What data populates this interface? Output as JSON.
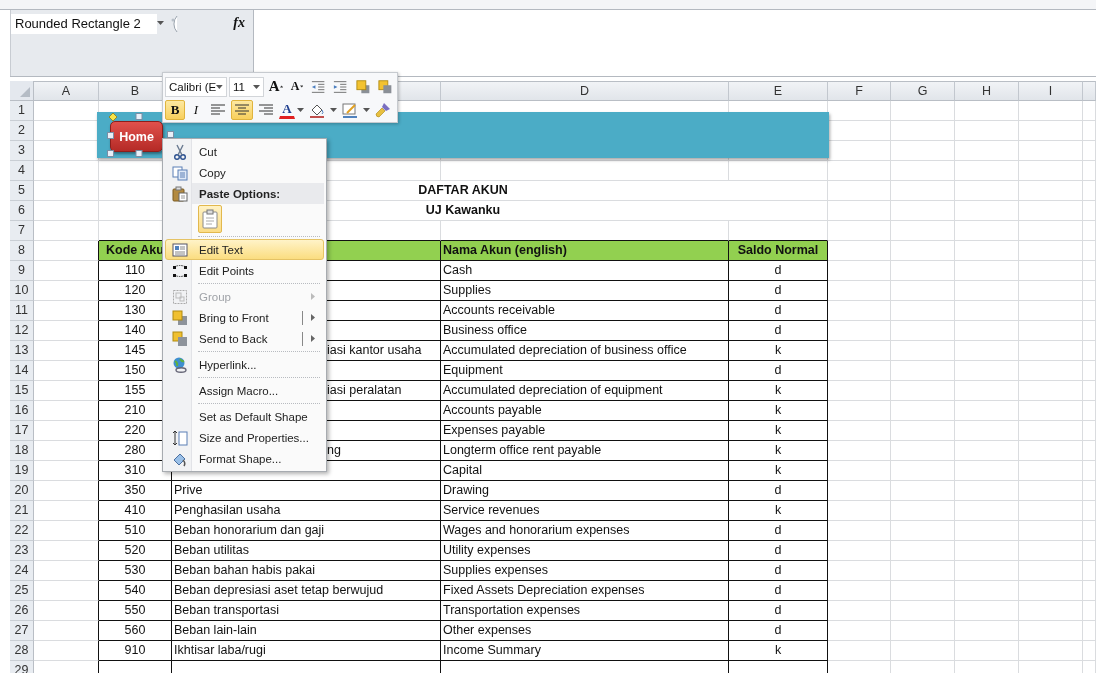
{
  "formula_bar": {
    "name_box": "Rounded Rectangle 2",
    "function_label": "fx"
  },
  "sheet": {
    "columns": [
      {
        "kind": "label",
        "label": "A"
      },
      {
        "kind": "label",
        "label": "B"
      },
      {
        "kind": "covered"
      },
      {
        "kind": "label",
        "label": "D"
      },
      {
        "kind": "label",
        "label": "E"
      },
      {
        "kind": "label",
        "label": "F"
      },
      {
        "kind": "label",
        "label": "G"
      },
      {
        "kind": "label",
        "label": "H"
      },
      {
        "kind": "label",
        "label": "I"
      }
    ],
    "rows": [
      {
        "number": "1",
        "kind": "under-shape"
      },
      {
        "number": "2",
        "kind": "under-shape"
      },
      {
        "number": "3",
        "kind": "under-shape"
      },
      {
        "number": "4",
        "kind": "empty"
      },
      {
        "number": "5",
        "kind": "title",
        "text": "DAFTAR AKUN"
      },
      {
        "number": "6",
        "kind": "title",
        "text": "UJ Kawanku"
      },
      {
        "number": "7",
        "kind": "empty"
      },
      {
        "number": "8",
        "kind": "header",
        "kode": "Kode Aku",
        "nama_english": "Nama Akun (english)",
        "saldo": "Saldo Normal"
      },
      {
        "number": "9",
        "kind": "data",
        "kode": "110",
        "nama_english": "Cash",
        "saldo": "d"
      },
      {
        "number": "10",
        "kind": "data",
        "kode": "120",
        "nama_english": "Supplies",
        "saldo": "d"
      },
      {
        "number": "11",
        "kind": "data",
        "kode": "130",
        "nama_english": "Accounts receivable",
        "saldo": "d"
      },
      {
        "number": "12",
        "kind": "data",
        "kode": "140",
        "nama_english": "Business office",
        "saldo": "d"
      },
      {
        "number": "13",
        "kind": "data",
        "kode": "145",
        "nama": "iasi kantor usaha",
        "covered": true,
        "nama_english": "Accumulated depreciation of business office",
        "saldo": "k"
      },
      {
        "number": "14",
        "kind": "data",
        "kode": "150",
        "nama_english": "Equipment",
        "saldo": "d"
      },
      {
        "number": "15",
        "kind": "data",
        "kode": "155",
        "nama": "iasi peralatan",
        "covered": true,
        "nama_english": "Accumulated depreciation of equipment",
        "saldo": "k"
      },
      {
        "number": "16",
        "kind": "data",
        "kode": "210",
        "nama_english": "Accounts payable",
        "saldo": "k"
      },
      {
        "number": "17",
        "kind": "data",
        "kode": "220",
        "nama_english": "Expenses payable",
        "saldo": "k"
      },
      {
        "number": "18",
        "kind": "data",
        "kode": "280",
        "nama": "ng",
        "covered": true,
        "nama_english": "Longterm office rent payable",
        "saldo": "k"
      },
      {
        "number": "19",
        "kind": "data",
        "kode": "310",
        "nama_english": "Capital",
        "saldo": "k"
      },
      {
        "number": "20",
        "kind": "data",
        "kode": "350",
        "nama": "Prive",
        "nama_english": "Drawing",
        "saldo": "d"
      },
      {
        "number": "21",
        "kind": "data",
        "kode": "410",
        "nama": "Penghasilan usaha",
        "nama_english": "Service revenues",
        "saldo": "k"
      },
      {
        "number": "22",
        "kind": "data",
        "kode": "510",
        "nama": "Beban honorarium dan gaji",
        "nama_english": "Wages and honorarium expenses",
        "saldo": "d"
      },
      {
        "number": "23",
        "kind": "data",
        "kode": "520",
        "nama": "Beban utilitas",
        "nama_english": "Utility expenses",
        "saldo": "d"
      },
      {
        "number": "24",
        "kind": "data",
        "kode": "530",
        "nama": "Beban bahan habis pakai",
        "nama_english": "Supplies expenses",
        "saldo": "d"
      },
      {
        "number": "25",
        "kind": "data",
        "kode": "540",
        "nama": "Beban depresiasi aset tetap berwujud",
        "nama_english": "Fixed Assets Depreciation expenses",
        "saldo": "d"
      },
      {
        "number": "26",
        "kind": "data",
        "kode": "550",
        "nama": "Beban transportasi",
        "nama_english": "Transportation expenses",
        "saldo": "d"
      },
      {
        "number": "27",
        "kind": "data",
        "kode": "560",
        "nama": "Beban lain-lain",
        "nama_english": "Other expenses",
        "saldo": "d"
      },
      {
        "number": "28",
        "kind": "data",
        "kode": "910",
        "nama": "Ikhtisar laba/rugi",
        "nama_english": "Income Summary",
        "saldo": "k"
      },
      {
        "number": "29",
        "kind": "blank"
      }
    ]
  },
  "shape": {
    "label": "Home"
  },
  "mini_toolbar": {
    "font": "Calibri (E",
    "size": "11",
    "row1": [
      {
        "kind": "grow-font",
        "label": "A"
      },
      {
        "kind": "shrink-font",
        "label": "A"
      },
      {
        "kind": "outdent"
      },
      {
        "kind": "indent"
      },
      {
        "kind": "bring-forward"
      },
      {
        "kind": "send-backward"
      }
    ],
    "row2": [
      {
        "kind": "bold",
        "label": "B",
        "selected": true
      },
      {
        "kind": "italic",
        "label": "I",
        "selected": false
      },
      {
        "kind": "align-left",
        "selected": false
      },
      {
        "kind": "align-center",
        "selected": true
      },
      {
        "kind": "align-right",
        "selected": false
      },
      {
        "kind": "font-color",
        "label": "A"
      },
      {
        "kind": "fill-color"
      },
      {
        "kind": "line-color"
      },
      {
        "kind": "format-painter"
      }
    ]
  },
  "context_menu": {
    "items": [
      {
        "kind": "cut",
        "label": "Cut",
        "selected": false,
        "disabled": false
      },
      {
        "kind": "copy",
        "label": "Copy",
        "selected": false,
        "disabled": false
      },
      {
        "kind": "header",
        "label": "Paste Options:"
      },
      {
        "kind": "paste-option"
      },
      {
        "kind": "separator"
      },
      {
        "kind": "edit-text",
        "label": "Edit Text",
        "selected": true,
        "disabled": false
      },
      {
        "kind": "edit-points",
        "label": "Edit Points",
        "selected": false,
        "disabled": false
      },
      {
        "kind": "separator"
      },
      {
        "kind": "group",
        "label": "Group",
        "selected": false,
        "disabled": true,
        "submenu": true,
        "split": false
      },
      {
        "kind": "bring-front",
        "label": "Bring to Front",
        "selected": false,
        "disabled": false,
        "submenu": true,
        "split": true
      },
      {
        "kind": "send-back",
        "label": "Send to Back",
        "selected": false,
        "disabled": false,
        "submenu": true,
        "split": true
      },
      {
        "kind": "separator"
      },
      {
        "kind": "hyperlink",
        "label": "Hyperlink...",
        "selected": false,
        "disabled": false
      },
      {
        "kind": "separator"
      },
      {
        "kind": "command",
        "label": "Assign Macro...",
        "selected": false,
        "disabled": false
      },
      {
        "kind": "separator"
      },
      {
        "kind": "command",
        "label": "Set as Default Shape",
        "selected": false,
        "disabled": false
      },
      {
        "kind": "size",
        "label": "Size and Properties...",
        "selected": false,
        "disabled": false
      },
      {
        "kind": "format",
        "label": "Format Shape...",
        "selected": false,
        "disabled": false
      }
    ]
  }
}
